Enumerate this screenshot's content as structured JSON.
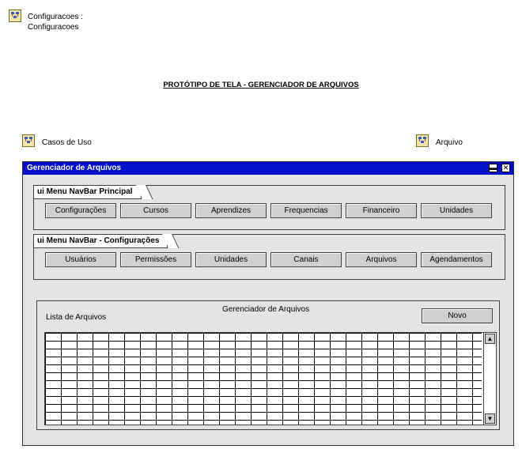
{
  "header": {
    "line1": "Configuracoes :",
    "line2": "Configuracoes"
  },
  "page_title": "PROTÓTIPO DE TELA - GERENCIADOR DE ARQUIVOS",
  "links": {
    "casos_de_uso": "Casos de Uso",
    "arquivo": "Arquivo"
  },
  "window": {
    "title": "Gerenciador de Arquivos",
    "minimize_glyph": "▬",
    "close_glyph": "✕"
  },
  "navbar_principal": {
    "label": "ui Menu NavBar Principal",
    "items": [
      "Configurações",
      "Cursos",
      "Aprendizes",
      "Frequencias",
      "Financeiro",
      "Unidades"
    ]
  },
  "navbar_config": {
    "label": "ui Menu NavBar - Configurações",
    "items": [
      "Usuários",
      "Permissões",
      "Unidades",
      "Canais",
      "Arquivos",
      "Agendamentos"
    ]
  },
  "panel": {
    "title": "Gerenciador de Arquivos",
    "list_label": "Lista de Arquivos",
    "new_button": "Novo"
  },
  "scrollbar": {
    "up_glyph": "▲",
    "down_glyph": "▼"
  },
  "icons": {
    "package": "package-icon"
  }
}
